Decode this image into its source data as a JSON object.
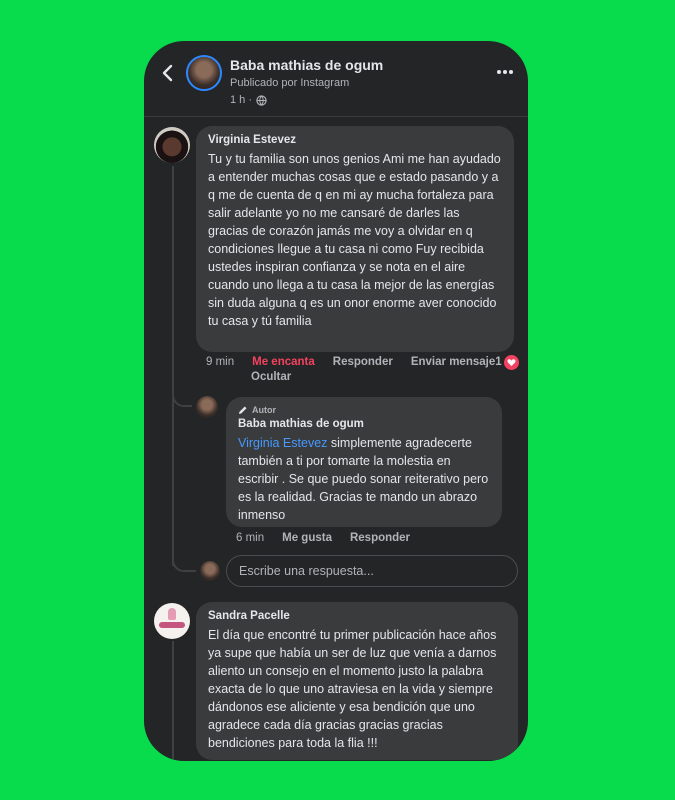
{
  "header": {
    "page_name": "Baba mathias de ogum",
    "subtitle": "Publicado por Instagram",
    "time": "1 h ·"
  },
  "comments": [
    {
      "author": "Virginia Estevez",
      "text": "Tu y tu familia son unos genios Ami me han ayudado a entender muchas cosas que e estado pasando y a q me de cuenta de q en mi ay mucha fortaleza para salir adelante yo no me cansaré de darles las gracias de corazón jamás me voy a olvidar en q condiciones llegue a tu casa ni como Fuy recibida ustedes inspiran confianza y se nota en el aire cuando uno llega a tu casa la mejor de las energías sin duda alguna q es un onor enorme aver conocido tu casa y tú familia",
      "time": "9 min",
      "like_label": "Me encanta",
      "reply_label": "Responder",
      "message_label": "Enviar mensaje",
      "reaction_count": "1",
      "hide_label": "Ocultar"
    },
    {
      "badge": "Autor",
      "author": "Baba mathias de ogum",
      "mention": "Virginia Estevez",
      "text": " simplemente agradecerte también a ti por tomarte la molestia en escribir . Se que puedo sonar reiterativo pero es la realidad. Gracias te mando un abrazo inmenso",
      "time": "6 min",
      "like_label": "Me gusta",
      "reply_label": "Responder"
    },
    {
      "author": "Sandra Pacelle",
      "text": "El día que encontré tu primer publicación hace años ya supe que había un ser de luz que venía a darnos aliento un consejo en el momento justo la palabra exacta de lo que uno atraviesa en la vida y siempre dándonos ese aliciente y esa bendición que uno agradece cada día gracias gracias gracias bendiciones para toda la flia !!!"
    }
  ],
  "reply_input": {
    "placeholder": "Escribe una respuesta..."
  },
  "colors": {
    "background": "#08dc4d",
    "panel": "#242526",
    "bubble": "#3a3b3c",
    "link": "#4599ff",
    "love": "#f3425f"
  }
}
